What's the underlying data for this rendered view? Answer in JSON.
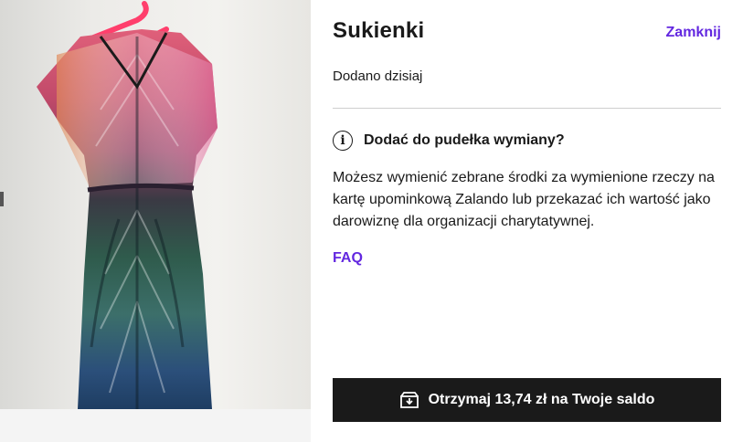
{
  "item": {
    "image_alt": "Sukienka",
    "title": "Sukienki",
    "added_text": "Dodano dzisiaj"
  },
  "header": {
    "close_label": "Zamknij"
  },
  "exchange": {
    "heading": "Dodać do pudełka wymiany?",
    "description": "Możesz wymienić zebrane środki za wymienione rzeczy na kartę upominkową Zalando lub przekazać ich wartość jako darowiznę dla organizacji charytatywnej.",
    "faq_label": "FAQ"
  },
  "cta": {
    "label": "Otrzymaj 13,74 zł na Twoje saldo",
    "icon": "box-icon"
  },
  "colors": {
    "accent": "#6328e0",
    "button_bg": "#1a1a1a",
    "hanger": "#ff3f6c"
  }
}
